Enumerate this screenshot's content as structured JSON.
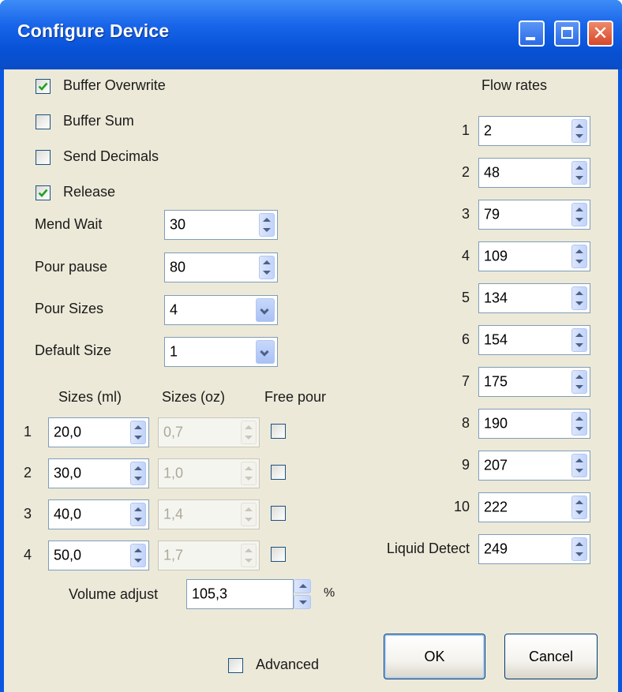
{
  "window": {
    "title": "Configure Device"
  },
  "options": {
    "buffer_overwrite": {
      "label": "Buffer Overwrite",
      "checked": true
    },
    "buffer_sum": {
      "label": "Buffer Sum",
      "checked": false
    },
    "send_decimals": {
      "label": "Send Decimals",
      "checked": false
    },
    "release": {
      "label": "Release",
      "checked": true
    }
  },
  "settings": {
    "mend_wait": {
      "label": "Mend Wait",
      "value": "30"
    },
    "pour_pause": {
      "label": "Pour pause",
      "value": "80"
    },
    "pour_sizes": {
      "label": "Pour Sizes",
      "value": "4"
    },
    "default_size": {
      "label": "Default Size",
      "value": "1"
    }
  },
  "sizes": {
    "headers": {
      "ml": "Sizes (ml)",
      "oz": "Sizes (oz)",
      "free": "Free pour"
    },
    "rows": [
      {
        "index": "1",
        "ml": "20,0",
        "oz": "0,7",
        "free_pour": false
      },
      {
        "index": "2",
        "ml": "30,0",
        "oz": "1,0",
        "free_pour": false
      },
      {
        "index": "3",
        "ml": "40,0",
        "oz": "1,4",
        "free_pour": false
      },
      {
        "index": "4",
        "ml": "50,0",
        "oz": "1,7",
        "free_pour": false
      }
    ]
  },
  "volume_adjust": {
    "label": "Volume adjust",
    "value": "105,3",
    "unit": "%"
  },
  "flow_rates": {
    "header": "Flow rates",
    "rows": [
      {
        "label": "1",
        "value": "2"
      },
      {
        "label": "2",
        "value": "48"
      },
      {
        "label": "3",
        "value": "79"
      },
      {
        "label": "4",
        "value": "109"
      },
      {
        "label": "5",
        "value": "134"
      },
      {
        "label": "6",
        "value": "154"
      },
      {
        "label": "7",
        "value": "175"
      },
      {
        "label": "8",
        "value": "190"
      },
      {
        "label": "9",
        "value": "207"
      },
      {
        "label": "10",
        "value": "222"
      },
      {
        "label": "Liquid Detect",
        "value": "249"
      }
    ]
  },
  "advanced": {
    "label": "Advanced",
    "checked": false
  },
  "buttons": {
    "ok": "OK",
    "cancel": "Cancel"
  },
  "colors": {
    "titlebar": "#0a58e0",
    "client": "#ece9d8",
    "field_border": "#7f9db9",
    "check": "#21a121"
  }
}
